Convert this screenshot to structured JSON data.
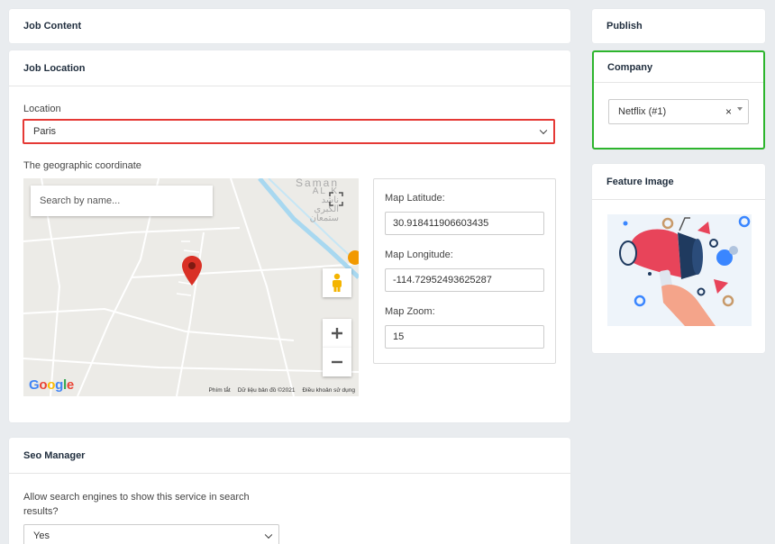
{
  "job_content": {
    "title": "Job Content"
  },
  "job_location": {
    "title": "Job Location",
    "location_label": "Location",
    "location_value": "Paris",
    "geo_label": "The geographic coordinate",
    "map": {
      "search_placeholder": "Search by name...",
      "google_letters": [
        "G",
        "o",
        "o",
        "g",
        "l",
        "e"
      ],
      "google_colors": [
        "#4285F4",
        "#EA4335",
        "#FBBC05",
        "#4285F4",
        "#34A853",
        "#EA4335"
      ],
      "footer": [
        "Phím tắt",
        "Dữ liệu bản đồ ©2021",
        "Điều khoản sử dụng"
      ],
      "place_text": [
        "Saman",
        "AL K",
        "ناشد",
        "الكبرى",
        "ستمعان"
      ]
    },
    "latitude_label": "Map Latitude:",
    "latitude_value": "30.918411906603435",
    "longitude_label": "Map Longitude:",
    "longitude_value": "-114.72952493625287",
    "zoom_label": "Map Zoom:",
    "zoom_value": "15"
  },
  "seo_manager": {
    "title": "Seo Manager",
    "allow_label": "Allow search engines to show this service in search results?",
    "allow_value": "Yes"
  },
  "publish": {
    "title": "Publish"
  },
  "company": {
    "title": "Company",
    "value": "Netflix (#1)",
    "clear": "×"
  },
  "feature_image": {
    "title": "Feature Image"
  },
  "colors": {
    "red_highlight": "#e53935",
    "green_highlight": "#2db52d",
    "marker": "#d93025"
  }
}
